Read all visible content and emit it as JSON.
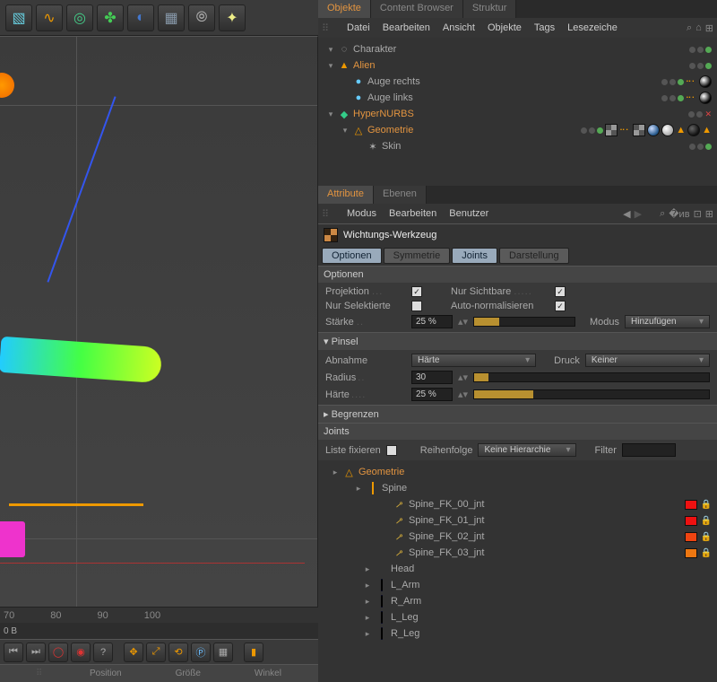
{
  "toolbar_icons": [
    "cube",
    "path",
    "subdiv",
    "clover",
    "boolean",
    "floor",
    "link",
    "light"
  ],
  "ruler": [
    "70",
    "80",
    "90",
    "100"
  ],
  "ruler_extra": "0 B",
  "bottom": {
    "pos": "Position",
    "size": "Größe",
    "angle": "Winkel"
  },
  "panels": {
    "objects": {
      "tabs": [
        "Objekte",
        "Content Browser",
        "Struktur"
      ],
      "active": 0,
      "menu": [
        "Datei",
        "Bearbeiten",
        "Ansicht",
        "Objekte",
        "Tags",
        "Lesezeiche"
      ],
      "tree": [
        {
          "depth": 0,
          "exp": "▾",
          "ico": "null",
          "label": "Charakter",
          "dots": [
            "gray",
            "gray",
            "g"
          ]
        },
        {
          "depth": 0,
          "exp": "▾",
          "ico": "poly",
          "label": "Alien",
          "orange": true,
          "dots": [
            "gray",
            "gray",
            "g"
          ]
        },
        {
          "depth": 1,
          "exp": "",
          "ico": "sphere",
          "label": "Auge rechts",
          "dots": [
            "gray",
            "gray",
            "g"
          ],
          "tags": [
            "dots",
            "ball"
          ]
        },
        {
          "depth": 1,
          "exp": "",
          "ico": "sphere",
          "label": "Auge links",
          "dots": [
            "gray",
            "gray",
            "g"
          ],
          "tags": [
            "dots",
            "ball"
          ]
        },
        {
          "depth": 0,
          "exp": "▾",
          "ico": "hnb",
          "label": "HyperNURBS",
          "orange": true,
          "dots": [
            "gray",
            "gray",
            "x"
          ]
        },
        {
          "depth": 1,
          "exp": "▾",
          "ico": "tri",
          "label": "Geometrie",
          "orange": true,
          "dots": [
            "gray",
            "gray",
            "g"
          ],
          "tags": [
            "tex",
            "dots",
            "tex",
            "sky",
            "white",
            "tri",
            "dark",
            "tri"
          ]
        },
        {
          "depth": 2,
          "exp": "",
          "ico": "skin",
          "label": "Skin",
          "dots": [
            "gray",
            "gray",
            "g"
          ]
        }
      ]
    },
    "attributes": {
      "tabs": [
        "Attribute",
        "Ebenen"
      ],
      "active": 0,
      "menu": [
        "Modus",
        "Bearbeiten",
        "Benutzer"
      ],
      "tool_title": "Wichtungs-Werkzeug",
      "subtabs": [
        "Optionen",
        "Symmetrie",
        "Joints",
        "Darstellung"
      ],
      "sections": {
        "optionen": {
          "title": "Optionen",
          "projektion": "Projektion",
          "nur_sichtbare": "Nur Sichtbare",
          "nur_selektierte": "Nur Selektierte",
          "auto_norm": "Auto-normalisieren",
          "staerke": "Stärke",
          "staerke_val": "25 %",
          "modus": "Modus",
          "modus_val": "Hinzufügen"
        },
        "pinsel": {
          "title": "Pinsel",
          "abnahme": "Abnahme",
          "abnahme_val": "Härte",
          "druck": "Druck",
          "druck_val": "Keiner",
          "radius": "Radius",
          "radius_val": "30",
          "haerte": "Härte",
          "haerte_val": "25 %"
        },
        "begrenzen": "Begrenzen",
        "joints": {
          "title": "Joints",
          "liste": "Liste fixieren",
          "reihenfolge": "Reihenfolge",
          "reihenfolge_val": "Keine Hierarchie",
          "filter": "Filter",
          "root": "Geometrie",
          "items": [
            {
              "label": "Spine",
              "type": "root"
            },
            {
              "label": "Spine_FK_00_jnt",
              "sw": "red"
            },
            {
              "label": "Spine_FK_01_jnt",
              "sw": "red"
            },
            {
              "label": "Spine_FK_02_jnt",
              "sw": "ored"
            },
            {
              "label": "Spine_FK_03_jnt",
              "sw": "or"
            },
            {
              "label": "Head",
              "type": "head"
            },
            {
              "label": "L_Arm",
              "type": "limb"
            },
            {
              "label": "R_Arm",
              "type": "limb"
            },
            {
              "label": "L_Leg",
              "type": "limb"
            },
            {
              "label": "R_Leg",
              "type": "limb"
            }
          ]
        }
      }
    }
  }
}
